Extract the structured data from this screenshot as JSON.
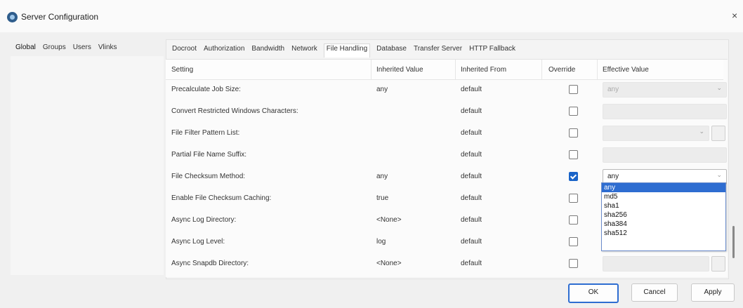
{
  "window": {
    "title": "Server Configuration",
    "close_glyph": "×",
    "icon": "app-icon"
  },
  "left_tabs": [
    "Global",
    "Groups",
    "Users",
    "Vlinks"
  ],
  "right_tabs": [
    "Docroot",
    "Authorization",
    "Bandwidth",
    "Network",
    "File Handling",
    "Database",
    "Transfer Server",
    "HTTP Fallback"
  ],
  "active_right_tab": "File Handling",
  "table": {
    "headers": {
      "setting": "Setting",
      "inherited_value": "Inherited Value",
      "inherited_from": "Inherited From",
      "override": "Override",
      "effective_value": "Effective Value"
    },
    "rows": [
      {
        "setting": "Precalculate Job Size:",
        "inherited_value": "any",
        "inherited_from": "default",
        "override": false,
        "effective": "any"
      },
      {
        "setting": "Convert Restricted Windows Characters:",
        "inherited_value": "",
        "inherited_from": "default",
        "override": false,
        "effective": ""
      },
      {
        "setting": "File Filter Pattern List:",
        "inherited_value": "",
        "inherited_from": "default",
        "override": false,
        "effective": ""
      },
      {
        "setting": "Partial File Name Suffix:",
        "inherited_value": "",
        "inherited_from": "default",
        "override": false,
        "effective": ""
      },
      {
        "setting": "File Checksum Method:",
        "inherited_value": "any",
        "inherited_from": "default",
        "override": true,
        "effective": "any"
      },
      {
        "setting": "Enable File Checksum Caching:",
        "inherited_value": "true",
        "inherited_from": "default",
        "override": false,
        "effective": ""
      },
      {
        "setting": "Async Log Directory:",
        "inherited_value": "<None>",
        "inherited_from": "default",
        "override": false,
        "effective": ""
      },
      {
        "setting": "Async Log Level:",
        "inherited_value": "log",
        "inherited_from": "default",
        "override": false,
        "effective": ""
      },
      {
        "setting": "Async Snapdb Directory:",
        "inherited_value": "<None>",
        "inherited_from": "default",
        "override": false,
        "effective": ""
      }
    ]
  },
  "dropdown": {
    "options": [
      "any",
      "md5",
      "sha1",
      "sha256",
      "sha384",
      "sha512"
    ],
    "selected": "any"
  },
  "buttons": {
    "ok": "OK",
    "cancel": "Cancel",
    "apply": "Apply"
  },
  "colors": {
    "accent": "#2e6dd1",
    "checked": "#1a64c8"
  }
}
